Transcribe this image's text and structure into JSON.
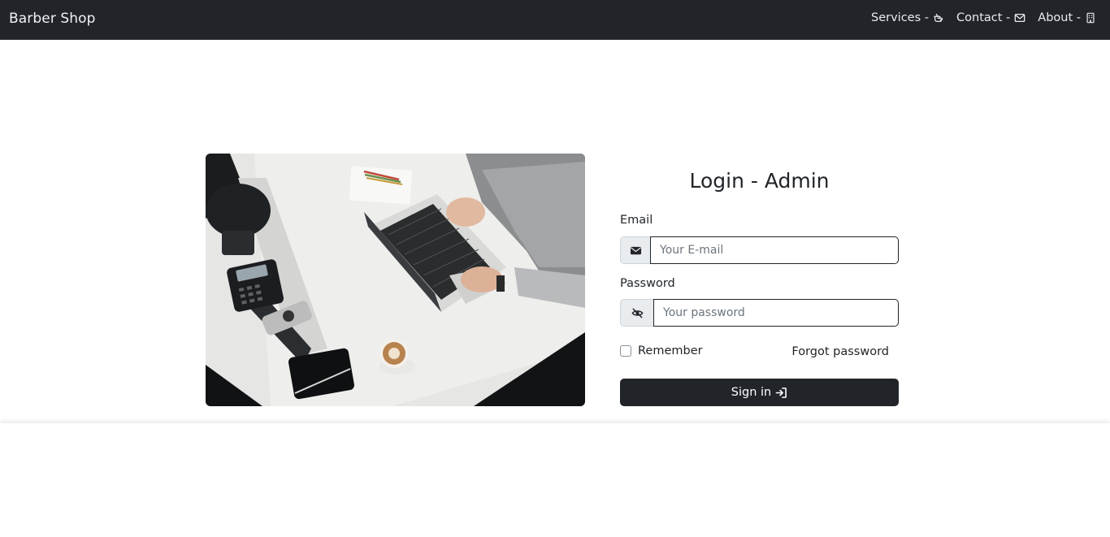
{
  "navbar": {
    "brand": "Barber Shop",
    "links": [
      {
        "label": "Services -",
        "icon": "hand-pointing-icon"
      },
      {
        "label": "Contact -",
        "icon": "envelope-icon"
      },
      {
        "label": "About -",
        "icon": "building-icon"
      }
    ]
  },
  "login": {
    "title": "Login - Admin",
    "email_label": "Email",
    "email_placeholder": "Your E-mail",
    "email_value": "",
    "password_label": "Password",
    "password_placeholder": "Your password",
    "password_value": "",
    "remember_label": "Remember",
    "remember_checked": false,
    "forgot_label": "Forgot password",
    "signin_label": "Sign in"
  },
  "colors": {
    "navbar_bg": "#212529",
    "button_bg": "#212529",
    "addon_bg": "#e9ecef",
    "text": "#212529"
  }
}
